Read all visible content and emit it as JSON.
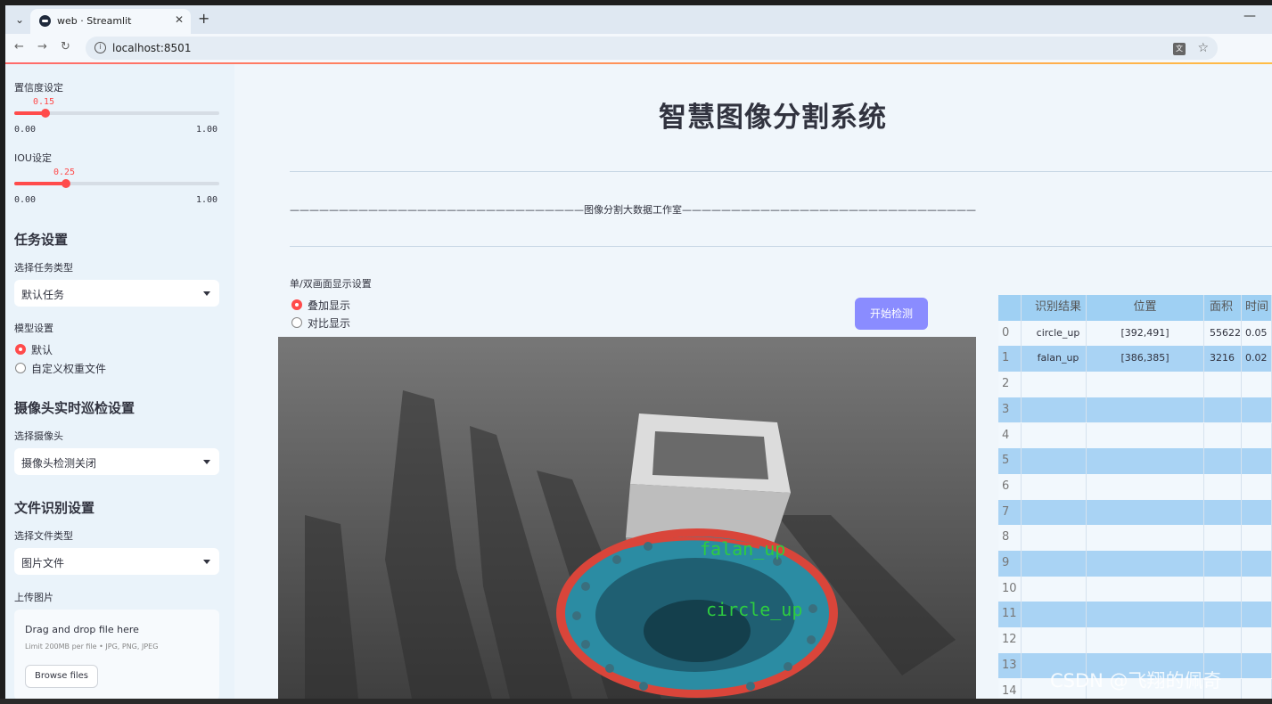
{
  "browser": {
    "tab_title": "web · Streamlit",
    "url": "localhost:8501"
  },
  "sidebar": {
    "confidence": {
      "label": "置信度设定",
      "value": "0.15",
      "min": "0.00",
      "max": "1.00",
      "fraction": 0.15
    },
    "iou": {
      "label": "IOU设定",
      "value": "0.25",
      "min": "0.00",
      "max": "1.00",
      "fraction": 0.25
    },
    "task": {
      "heading": "任务设置",
      "label": "选择任务类型",
      "selected": "默认任务"
    },
    "model": {
      "label": "模型设置",
      "options": [
        "默认",
        "自定义权重文件"
      ],
      "selected_index": 0
    },
    "camera": {
      "heading": "摄像头实时巡检设置",
      "label": "选择摄像头",
      "selected": "摄像头检测关闭"
    },
    "file": {
      "heading": "文件识别设置",
      "label": "选择文件类型",
      "selected": "图片文件"
    },
    "upload": {
      "label": "上传图片",
      "title": "Drag and drop file here",
      "subtitle": "Limit 200MB per file • JPG, PNG, JPEG",
      "button": "Browse files"
    }
  },
  "main": {
    "title": "智慧图像分割系统",
    "banner": "——————————————————————————————图像分割大数据工作室——————————————————————————————",
    "display_mode": {
      "label": "单/双画面显示设置",
      "options": [
        "叠加显示",
        "对比显示"
      ],
      "selected_index": 0
    },
    "detect_button": "开始检测",
    "detections": [
      {
        "label": "falan_up"
      },
      {
        "label": "circle_up"
      }
    ]
  },
  "results_table": {
    "headers": [
      "",
      "识别结果",
      "位置",
      "面积",
      "时间"
    ],
    "rows": [
      [
        "0",
        "circle_up",
        "[392,491]",
        "55622",
        "0.05"
      ],
      [
        "1",
        "falan_up",
        "[386,385]",
        "3216",
        "0.02"
      ],
      [
        "2",
        "",
        "",
        "",
        ""
      ],
      [
        "3",
        "",
        "",
        "",
        ""
      ],
      [
        "4",
        "",
        "",
        "",
        ""
      ],
      [
        "5",
        "",
        "",
        "",
        ""
      ],
      [
        "6",
        "",
        "",
        "",
        ""
      ],
      [
        "7",
        "",
        "",
        "",
        ""
      ],
      [
        "8",
        "",
        "",
        "",
        ""
      ],
      [
        "9",
        "",
        "",
        "",
        ""
      ],
      [
        "10",
        "",
        "",
        "",
        ""
      ],
      [
        "11",
        "",
        "",
        "",
        ""
      ],
      [
        "12",
        "",
        "",
        "",
        ""
      ],
      [
        "13",
        "",
        "",
        "",
        ""
      ],
      [
        "14",
        "",
        "",
        "",
        ""
      ]
    ]
  },
  "watermark": "CSDN @飞翔的佩奇",
  "colors": {
    "accent": "#ff4b4b",
    "button": "#8a8cff",
    "table_head": "#9fd0f3",
    "table_stripe": "#a9d3f4",
    "label_green": "#2ecc40",
    "mask_red": "#d9453a",
    "mask_teal": "#2b8ca3"
  }
}
